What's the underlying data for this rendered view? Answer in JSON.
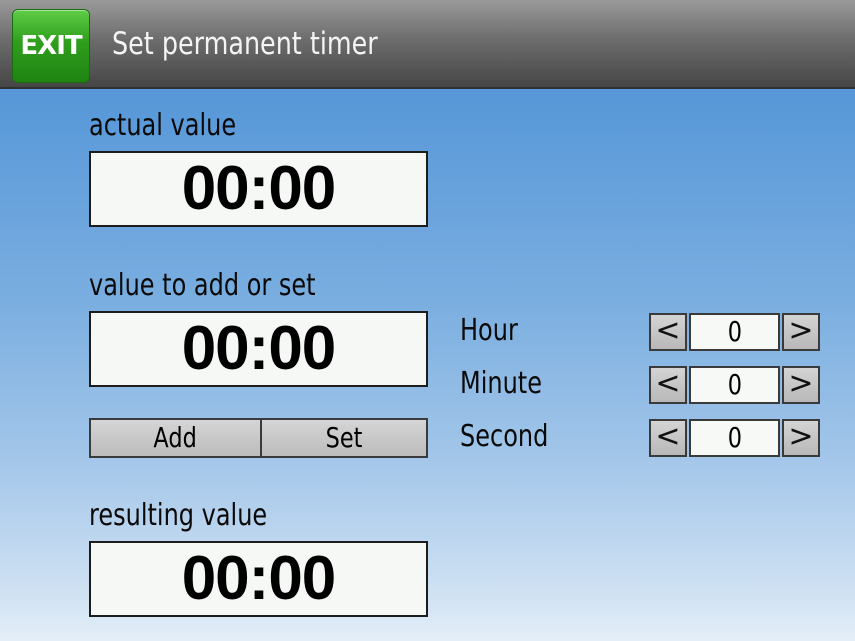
{
  "header": {
    "exit_label": "EXIT",
    "title": "Set permanent timer"
  },
  "actual": {
    "label": "actual value",
    "value": "00:00"
  },
  "delta": {
    "label": "value to add or set",
    "value": "00:00"
  },
  "buttons": {
    "add_label": "Add",
    "set_label": "Set"
  },
  "fields": [
    {
      "label": "Hour",
      "value": "0",
      "decrease": "<",
      "increase": ">"
    },
    {
      "label": "Minute",
      "value": "0",
      "decrease": "<",
      "increase": ">"
    },
    {
      "label": "Second",
      "value": "0",
      "decrease": "<",
      "increase": ">"
    }
  ],
  "result": {
    "label": "resulting value",
    "value": "00:00"
  },
  "colors": {
    "exit_button": "#2f9e1c",
    "header_bar": "#5e5e5e",
    "background_top": "#4d8fd4",
    "background_bottom": "#e4eef8"
  }
}
